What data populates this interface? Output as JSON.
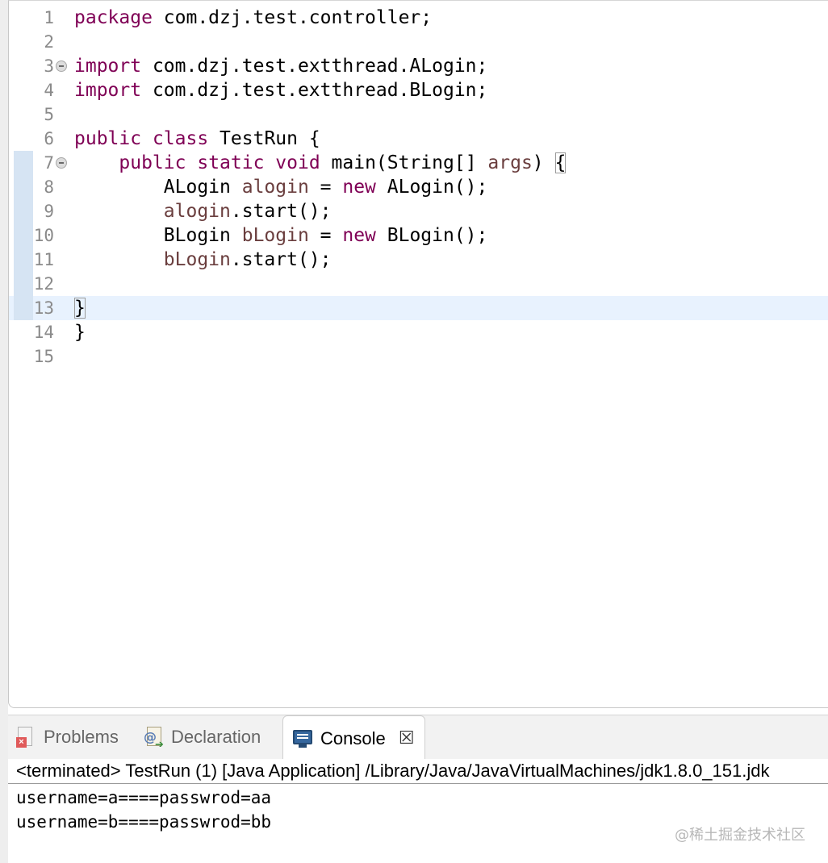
{
  "editor": {
    "lines": [
      {
        "n": "1",
        "tokens": [
          {
            "t": "package",
            "c": "kw"
          },
          {
            "t": " com.dzj.test.controller;",
            "c": ""
          }
        ]
      },
      {
        "n": "2",
        "tokens": []
      },
      {
        "n": "3",
        "fold": true,
        "tokens": [
          {
            "t": "import",
            "c": "kw"
          },
          {
            "t": " com.dzj.test.extthread.ALogin;",
            "c": ""
          }
        ]
      },
      {
        "n": "4",
        "tokens": [
          {
            "t": "import",
            "c": "kw"
          },
          {
            "t": " com.dzj.test.extthread.BLogin;",
            "c": ""
          }
        ]
      },
      {
        "n": "5",
        "tokens": []
      },
      {
        "n": "6",
        "tokens": [
          {
            "t": "public",
            "c": "kw"
          },
          {
            "t": " ",
            "c": ""
          },
          {
            "t": "class",
            "c": "kw"
          },
          {
            "t": " TestRun {",
            "c": ""
          }
        ]
      },
      {
        "n": "7",
        "fold": true,
        "mark": true,
        "tokens": [
          {
            "t": "    ",
            "c": ""
          },
          {
            "t": "public",
            "c": "kw"
          },
          {
            "t": " ",
            "c": ""
          },
          {
            "t": "static",
            "c": "kw"
          },
          {
            "t": " ",
            "c": ""
          },
          {
            "t": "void",
            "c": "kw"
          },
          {
            "t": " main(String[] ",
            "c": ""
          },
          {
            "t": "args",
            "c": "var"
          },
          {
            "t": ") ",
            "c": ""
          },
          {
            "t": "{",
            "c": "caret-bracket"
          }
        ]
      },
      {
        "n": "8",
        "mark": true,
        "tokens": [
          {
            "t": "        ALogin ",
            "c": ""
          },
          {
            "t": "alogin",
            "c": "var"
          },
          {
            "t": " = ",
            "c": ""
          },
          {
            "t": "new",
            "c": "kw"
          },
          {
            "t": " ALogin();",
            "c": ""
          }
        ]
      },
      {
        "n": "9",
        "mark": true,
        "tokens": [
          {
            "t": "        ",
            "c": ""
          },
          {
            "t": "alogin",
            "c": "var"
          },
          {
            "t": ".start();",
            "c": ""
          }
        ]
      },
      {
        "n": "10",
        "mark": true,
        "tokens": [
          {
            "t": "        BLogin ",
            "c": ""
          },
          {
            "t": "bLogin",
            "c": "var"
          },
          {
            "t": " = ",
            "c": ""
          },
          {
            "t": "new",
            "c": "kw"
          },
          {
            "t": " BLogin();",
            "c": ""
          }
        ]
      },
      {
        "n": "11",
        "mark": true,
        "tokens": [
          {
            "t": "        ",
            "c": ""
          },
          {
            "t": "bLogin",
            "c": "var"
          },
          {
            "t": ".start();",
            "c": ""
          }
        ]
      },
      {
        "n": "12",
        "mark": true,
        "tokens": []
      },
      {
        "n": "13",
        "mark": true,
        "current": true,
        "tokens": [
          {
            "t": "}",
            "c": "caret-bracket"
          }
        ]
      },
      {
        "n": "14",
        "tokens": [
          {
            "t": "}",
            "c": ""
          }
        ]
      },
      {
        "n": "15",
        "tokens": []
      }
    ]
  },
  "tabs": {
    "problems": {
      "label": "Problems",
      "icon": "problems-icon"
    },
    "declaration": {
      "label": "Declaration",
      "icon": "declaration-icon"
    },
    "console": {
      "label": "Console",
      "icon": "console-icon",
      "close": "☒"
    }
  },
  "console": {
    "header": "<terminated> TestRun (1) [Java Application] /Library/Java/JavaVirtualMachines/jdk1.8.0_151.jdk",
    "output": [
      "username=a====passwrod=aa",
      "username=b====passwrod=bb"
    ]
  },
  "watermark": "@稀土掘金技术社区",
  "colors": {
    "keyword": "#7f0055",
    "local_var": "#6a3e3e",
    "current_line": "#e8f2fe"
  }
}
